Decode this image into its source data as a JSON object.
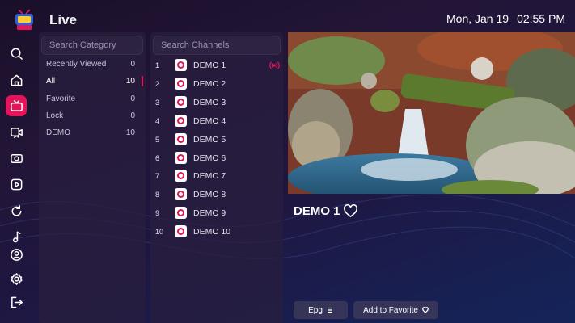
{
  "header": {
    "title": "Live",
    "date": "Mon, Jan 19",
    "time": "02:55 PM",
    "logo_icon": "tv-brand-logo"
  },
  "sidebar": {
    "items": [
      {
        "icon": "search-icon",
        "active": false
      },
      {
        "icon": "home-icon",
        "active": false
      },
      {
        "icon": "tv-icon",
        "active": true
      },
      {
        "icon": "movie-icon",
        "active": false
      },
      {
        "icon": "series-icon",
        "active": false
      },
      {
        "icon": "play-icon",
        "active": false
      },
      {
        "icon": "replay-icon",
        "active": false
      },
      {
        "icon": "music-icon",
        "active": false
      },
      {
        "icon": "profile-icon",
        "active": false
      },
      {
        "icon": "settings-icon",
        "active": false
      },
      {
        "icon": "logout-icon",
        "active": false
      }
    ]
  },
  "categories": {
    "search_placeholder": "Search Category",
    "items": [
      {
        "name": "Recently Viewed",
        "count": "0"
      },
      {
        "name": "All",
        "count": "10",
        "selected": true
      },
      {
        "name": "Favorite",
        "count": "0"
      },
      {
        "name": "Lock",
        "count": "0"
      },
      {
        "name": "DEMO",
        "count": "10"
      }
    ]
  },
  "channels": {
    "search_placeholder": "Search Channels",
    "items": [
      {
        "num": "1",
        "name": "DEMO 1",
        "playing": true
      },
      {
        "num": "2",
        "name": "DEMO 2"
      },
      {
        "num": "3",
        "name": "DEMO 3"
      },
      {
        "num": "4",
        "name": "DEMO 4"
      },
      {
        "num": "5",
        "name": "DEMO 5"
      },
      {
        "num": "6",
        "name": "DEMO 6"
      },
      {
        "num": "7",
        "name": "DEMO 7"
      },
      {
        "num": "8",
        "name": "DEMO 8"
      },
      {
        "num": "9",
        "name": "DEMO 9"
      },
      {
        "num": "10",
        "name": "DEMO 10"
      }
    ]
  },
  "player": {
    "now_playing": "DEMO 1",
    "epg_label": "Epg",
    "favorite_label": "Add to Favorite"
  },
  "colors": {
    "accent": "#e6145a",
    "background": "#1f1640"
  }
}
